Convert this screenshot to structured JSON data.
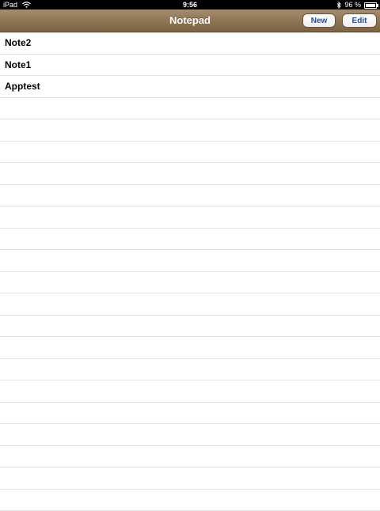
{
  "status_bar": {
    "device": "iPad",
    "time": "9:56",
    "battery_text": "96 %",
    "battery_level": 0.96,
    "icons": [
      "wifi-icon",
      "bluetooth-icon",
      "battery-icon"
    ]
  },
  "nav_bar": {
    "title": "Notepad",
    "new_label": "New",
    "edit_label": "Edit",
    "bar_color": "#8f7654",
    "button_text_color": "#2d4f8a"
  },
  "notes": [
    {
      "title": "Note2"
    },
    {
      "title": "Note1"
    },
    {
      "title": "Apptest"
    },
    {
      "title": ""
    },
    {
      "title": ""
    },
    {
      "title": ""
    },
    {
      "title": ""
    },
    {
      "title": ""
    },
    {
      "title": ""
    },
    {
      "title": ""
    },
    {
      "title": ""
    },
    {
      "title": ""
    },
    {
      "title": ""
    },
    {
      "title": ""
    },
    {
      "title": ""
    },
    {
      "title": ""
    },
    {
      "title": ""
    },
    {
      "title": ""
    },
    {
      "title": ""
    },
    {
      "title": ""
    },
    {
      "title": ""
    },
    {
      "title": ""
    }
  ]
}
